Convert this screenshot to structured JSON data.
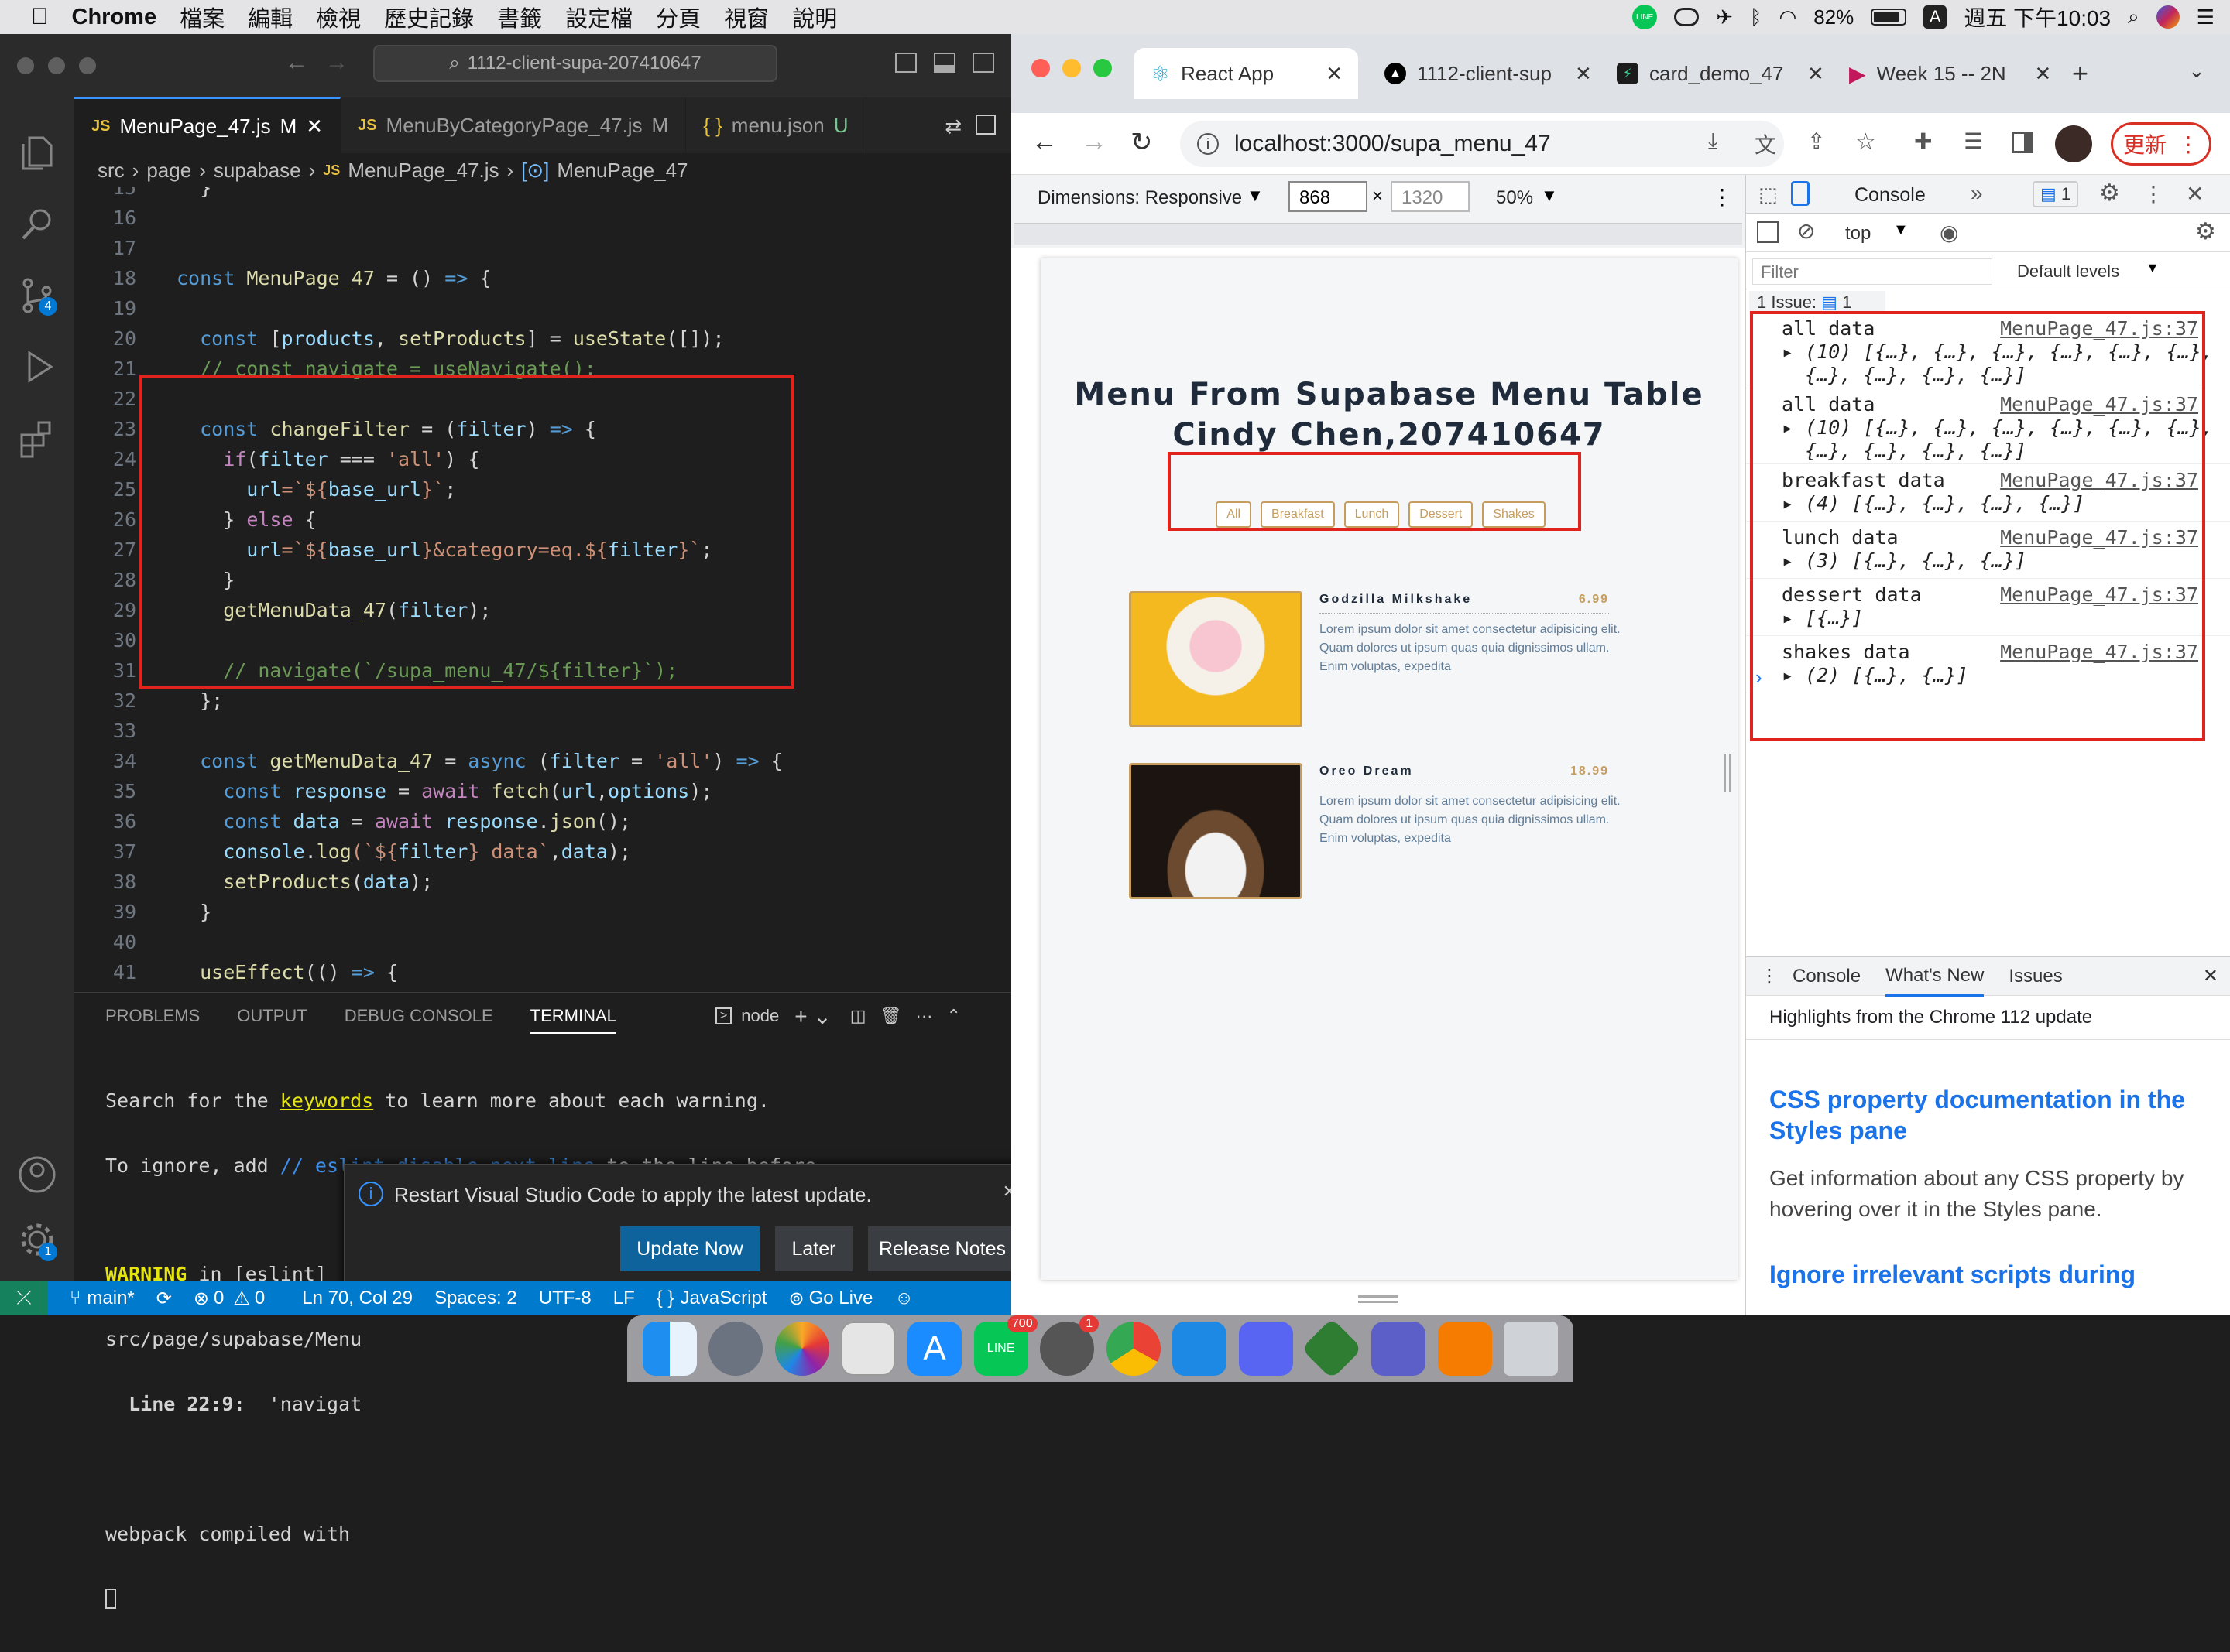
{
  "menubar": {
    "app": "Chrome",
    "items": [
      "檔案",
      "編輯",
      "檢視",
      "歷史記錄",
      "書籤",
      "設定檔",
      "分頁",
      "視窗",
      "說明"
    ],
    "battery": "82%",
    "input": "A",
    "datetime": "週五 下午10:03"
  },
  "vscode": {
    "search": "1112-client-supa-207410647",
    "tabs": [
      {
        "label": "MenuPage_47.js",
        "status": "M"
      },
      {
        "label": "MenuByCategoryPage_47.js",
        "status": "M"
      },
      {
        "label": "menu.json",
        "status": "U"
      }
    ],
    "breadcrumb": [
      "src",
      "page",
      "supabase",
      "MenuPage_47.js",
      "MenuPage_47"
    ],
    "scm_badge": "4",
    "settings_badge": "1",
    "panel_tabs": [
      "PROBLEMS",
      "OUTPUT",
      "DEBUG CONSOLE",
      "TERMINAL"
    ],
    "terminal_shell": "node",
    "terminal_lines": [
      "Search for the keywords to learn more about each warning.",
      "To ignore, add // eslint-disable-next-line to the line before.",
      "",
      "WARNING in [eslint]",
      "src/page/supabase/Menu",
      "  Line 22:9:  'navigat",
      "",
      "webpack compiled with"
    ],
    "notification": {
      "text": "Restart Visual Studio Code to apply the latest update.",
      "primary": "Update Now",
      "later": "Later",
      "notes": "Release Notes"
    },
    "status": {
      "branch": "main*",
      "errors": "0",
      "warnings": "0",
      "position": "Ln 70, Col 29",
      "spaces": "Spaces: 2",
      "encoding": "UTF-8",
      "eol": "LF",
      "language": "JavaScript",
      "golive": "Go Live"
    }
  },
  "chrome": {
    "tabs": [
      "React App",
      "1112-client-sup",
      "card_demo_47",
      "Week 15 -- 2N"
    ],
    "url": "localhost:3000/supa_menu_47",
    "update": "更新",
    "device": {
      "dimensions": "Dimensions: Responsive",
      "width": "868",
      "height": "1320",
      "zoom": "50%"
    },
    "page": {
      "title1": "Menu From Supabase Menu Table",
      "title2": "Cindy Chen,207410647",
      "filters": [
        "All",
        "Breakfast",
        "Lunch",
        "Dessert",
        "Shakes"
      ],
      "items": [
        {
          "name": "Godzilla Milkshake",
          "price": "6.99",
          "desc": "Lorem ipsum dolor sit amet consectetur adipisicing elit. Quam dolores ut ipsum quas quia dignissimos ullam. Enim voluptas, expedita"
        },
        {
          "name": "Oreo Dream",
          "price": "18.99",
          "desc": "Lorem ipsum dolor sit amet consectetur adipisicing elit. Quam dolores ut ipsum quas quia dignissimos ullam. Enim voluptas, expedita"
        }
      ]
    },
    "devtools": {
      "tab": "Console",
      "issues_badge": "1",
      "context": "top",
      "filter_placeholder": "Filter",
      "levels": "Default levels",
      "issue_bar": "1 Issue:",
      "issue_count": "1",
      "logs": [
        {
          "msg": "all data",
          "src": "MenuPage_47.js:37",
          "arr": "(10) [{…}, {…}, {…}, {…}, {…}, {…},\n{…}, {…}, {…}, {…}]"
        },
        {
          "msg": "all data",
          "src": "MenuPage_47.js:37",
          "arr": "(10) [{…}, {…}, {…}, {…}, {…}, {…},\n{…}, {…}, {…}, {…}]"
        },
        {
          "msg": "breakfast data",
          "src": "MenuPage_47.js:37",
          "arr": "(4) [{…}, {…}, {…}, {…}]"
        },
        {
          "msg": "lunch data",
          "src": "MenuPage_47.js:37",
          "arr": "(3) [{…}, {…}, {…}]"
        },
        {
          "msg": "dessert data",
          "src": "MenuPage_47.js:37",
          "arr": "[{…}]"
        },
        {
          "msg": "shakes data",
          "src": "MenuPage_47.js:37",
          "arr": "(2) [{…}, {…}]"
        }
      ],
      "drawer_tabs": [
        "Console",
        "What's New",
        "Issues"
      ],
      "whatsnew": {
        "header": "Highlights from the Chrome 112 update",
        "h1": "CSS property documentation in the Styles pane",
        "p1": "Get information about any CSS property by hovering over it in the Styles pane.",
        "h2": "Ignore irrelevant scripts during"
      }
    }
  },
  "dock": {
    "line_badge": "700",
    "settings_badge": "1"
  }
}
